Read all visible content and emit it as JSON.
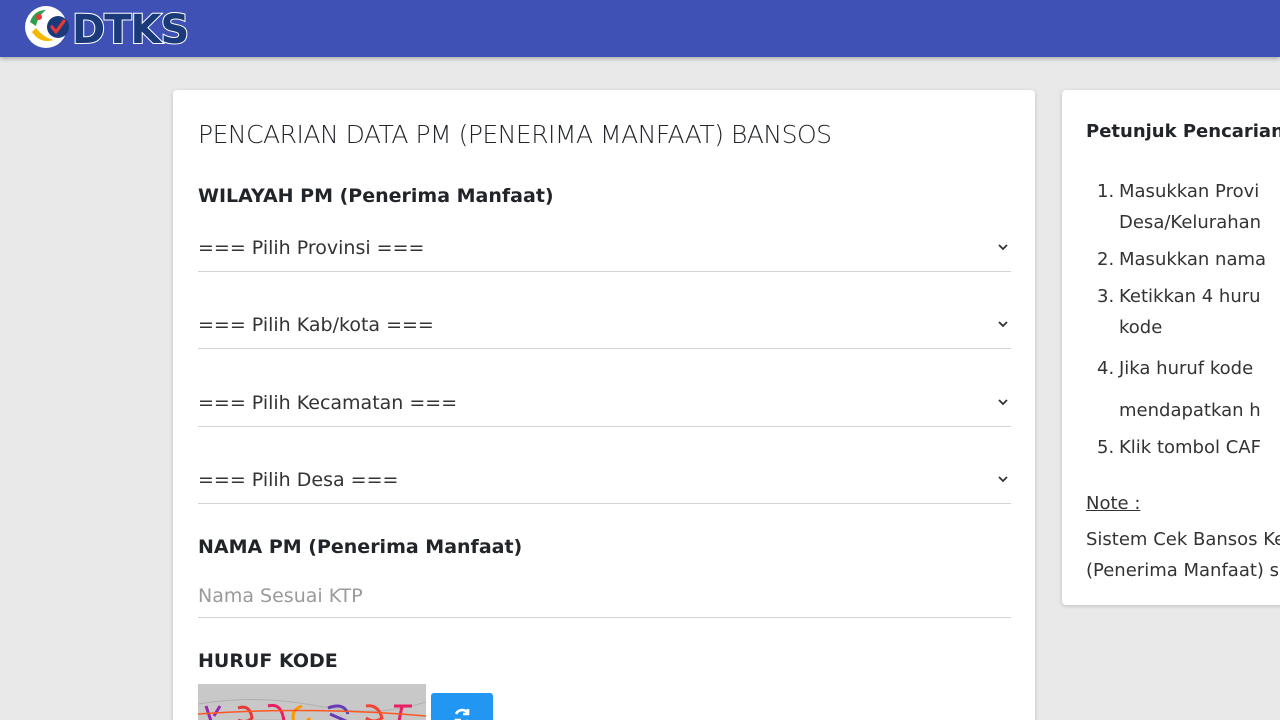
{
  "header": {
    "logo_text": "DTKS",
    "bar_color": "#3f51b5"
  },
  "form": {
    "title": "PENCARIAN DATA PM (PENERIMA MANFAAT) BANSOS",
    "wilayah_label": "WILAYAH PM (Penerima Manfaat)",
    "provinsi_select": "=== Pilih Provinsi ===",
    "kabkota_select": "=== Pilih Kab/kota ===",
    "kecamatan_select": "=== Pilih Kecamatan ===",
    "desa_select": "=== Pilih Desa ===",
    "nama_label": "NAMA PM (Penerima Manfaat)",
    "nama_placeholder": "Nama Sesuai KTP",
    "nama_value": "",
    "kode_label": "HURUF KODE",
    "refresh_icon": "refresh-icon",
    "refresh_color": "#2196f3"
  },
  "petunjuk": {
    "title": "Petunjuk Pencarian",
    "steps": [
      {
        "num": "1.",
        "line1": "Masukkan Provi",
        "line2": "Desa/Kelurahan"
      },
      {
        "num": "2.",
        "line1": "Masukkan nama"
      },
      {
        "num": "3.",
        "line1": "Ketikkan 4 huru",
        "line2": "kode"
      },
      {
        "num": "4.",
        "line1": "Jika huruf kode",
        "line2": "mendapatkan h"
      },
      {
        "num": "5.",
        "line1": "Klik tombol CAF"
      }
    ],
    "note_label": "Note :",
    "note_line1": "Sistem Cek Bansos Ke",
    "note_line2": "(Penerima Manfaat) se"
  }
}
